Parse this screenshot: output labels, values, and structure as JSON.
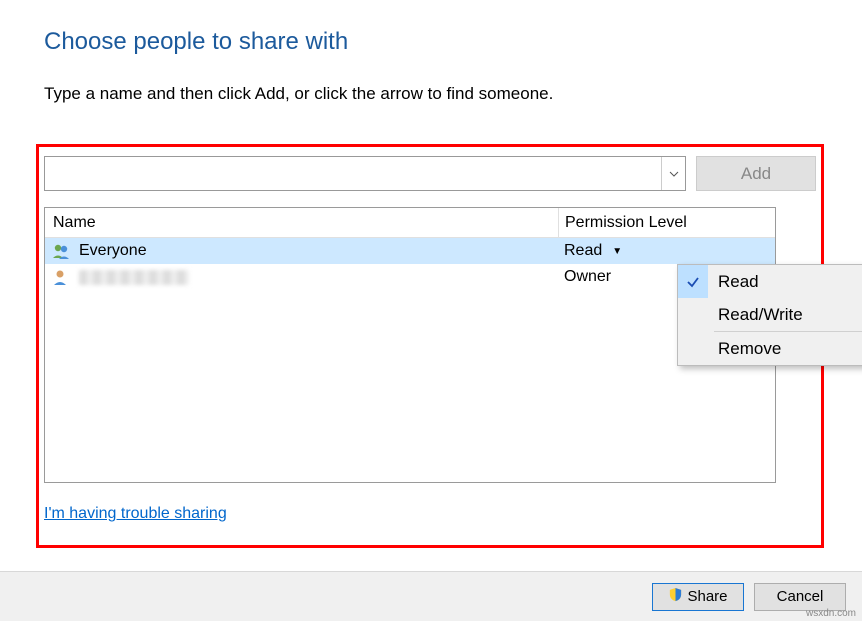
{
  "title": "Choose people to share with",
  "subtitle": "Type a name and then click Add, or click the arrow to find someone.",
  "input": {
    "value": "",
    "placeholder": ""
  },
  "add_button": "Add",
  "table": {
    "columns": {
      "name": "Name",
      "permission": "Permission Level"
    },
    "rows": [
      {
        "name": "Everyone",
        "permission": "Read",
        "selected": true
      },
      {
        "name": "",
        "permission": "Owner",
        "selected": false
      }
    ]
  },
  "permission_menu": {
    "items": [
      {
        "label": "Read",
        "checked": true
      },
      {
        "label": "Read/Write",
        "checked": false
      }
    ],
    "separator": true,
    "remove": "Remove"
  },
  "trouble_link": "I'm having trouble sharing",
  "footer": {
    "share": "Share",
    "cancel": "Cancel"
  },
  "watermark": "wsxdn.com"
}
